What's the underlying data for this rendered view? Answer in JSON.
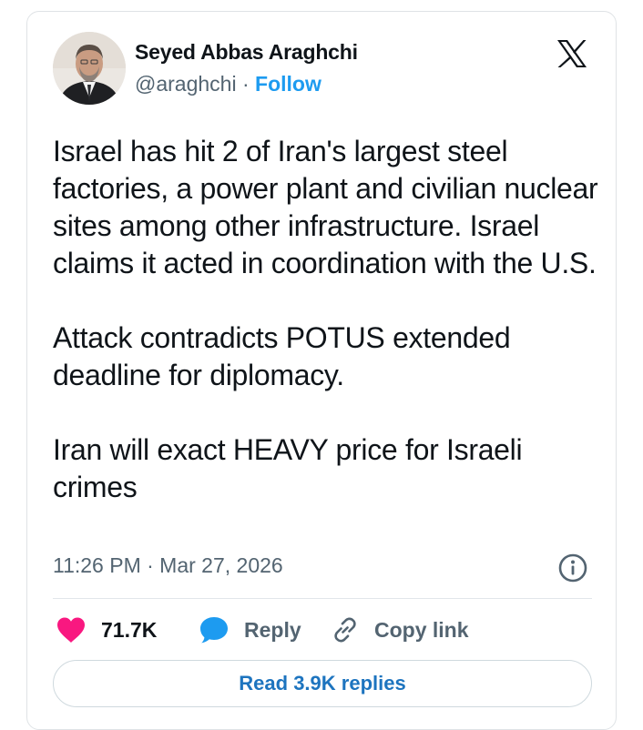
{
  "author": {
    "name": "Seyed Abbas Araghchi",
    "handle": "@araghchi",
    "separator": "·",
    "follow_label": "Follow"
  },
  "tweet": {
    "paragraphs": [
      "Israel has hit 2 of Iran's largest steel factories, a power plant and civilian nuclear sites among other infrastructure. Israel claims it acted in coordination with the U.S.",
      "Attack contradicts POTUS extended deadline for diplomacy.",
      "Iran will exact HEAVY price for Israeli crimes"
    ],
    "timestamp": "11:26 PM · Mar 27, 2026"
  },
  "actions": {
    "likes": "71.7K",
    "reply_label": "Reply",
    "copy_label": "Copy link",
    "read_replies_label": "Read 3.9K replies"
  },
  "icons": {
    "platform": "x-logo-icon",
    "like": "heart-icon",
    "reply": "speech-bubble-icon",
    "copy": "link-icon",
    "info": "info-icon"
  },
  "colors": {
    "accent": "#1d9bf0",
    "like": "#f91880",
    "reply": "#1d9bf0",
    "text": "#0f1419",
    "muted": "#536471"
  }
}
